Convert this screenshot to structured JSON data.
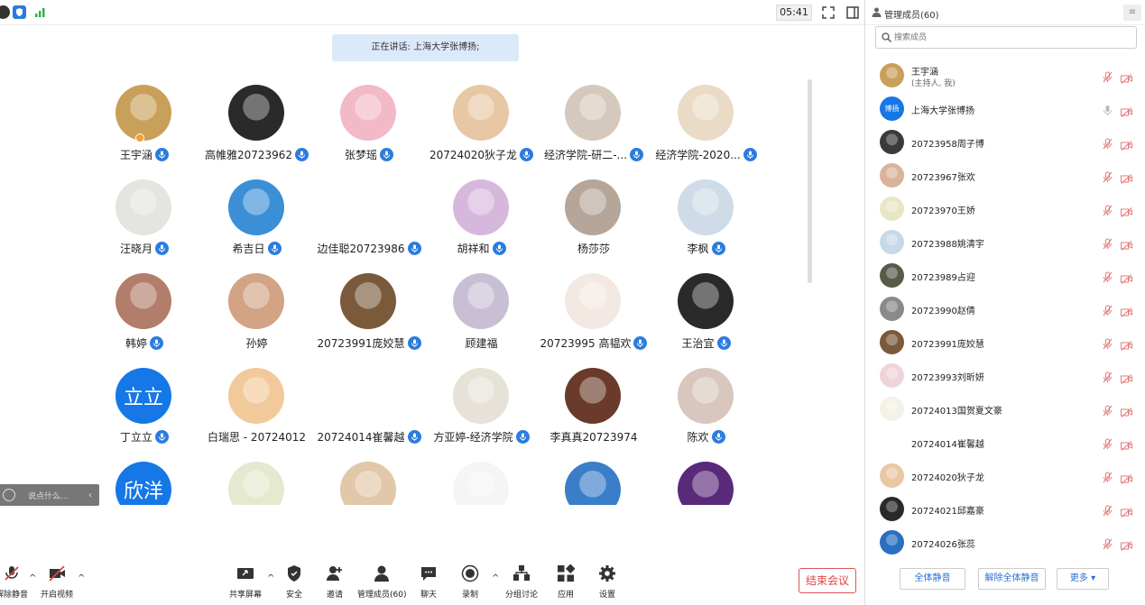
{
  "top": {
    "timer": "05:41",
    "speaking": "正在讲话: 上海大学张博扬;"
  },
  "participants": [
    {
      "name": "王宇涵",
      "mic": true,
      "bg": "#c9a05a",
      "host": true
    },
    {
      "name": "高帷雅20723962",
      "mic": true,
      "bg": "#2a2a2a"
    },
    {
      "name": "张梦瑶",
      "mic": true,
      "bg": "#f2b9c6"
    },
    {
      "name": "20724020狄子龙",
      "mic": true,
      "bg": "#e8c7a4"
    },
    {
      "name": "经济学院-研二-...",
      "mic": true,
      "bg": "#d5c8bc"
    },
    {
      "name": "经济学院-2020...",
      "mic": true,
      "bg": "#eadbc6"
    },
    {
      "name": "汪晓月",
      "mic": true,
      "bg": "#e4e4e0"
    },
    {
      "name": "希吉日",
      "mic": true,
      "bg": "#3b8fd6"
    },
    {
      "name": "边佳聪20723986",
      "mic": true,
      "bg": "#ffffff"
    },
    {
      "name": "胡祥和",
      "mic": true,
      "bg": "#d7b8dd"
    },
    {
      "name": "杨莎莎",
      "mic": false,
      "bg": "#b6a69a"
    },
    {
      "name": "李枫",
      "mic": true,
      "bg": "#cfdce7"
    },
    {
      "name": "韩婷",
      "mic": true,
      "bg": "#b27d6a"
    },
    {
      "name": "孙婷",
      "mic": false,
      "bg": "#d2a384"
    },
    {
      "name": "20723991庞姣慧",
      "mic": true,
      "bg": "#7a5a3a"
    },
    {
      "name": "顾建福",
      "mic": false,
      "bg": "#c9bfd5"
    },
    {
      "name": "20723995 高韫欢",
      "mic": true,
      "bg": "#f4e8e2"
    },
    {
      "name": "王治宜",
      "mic": true,
      "bg": "#2a2a2a"
    },
    {
      "name": "丁立立",
      "mic": true,
      "bg": "#1677e6",
      "text": "立立"
    },
    {
      "name": "白瑞思 - 20724012",
      "mic": false,
      "bg": "#f2c99a"
    },
    {
      "name": "20724014崔馨越",
      "mic": true,
      "bg": "#ffffff"
    },
    {
      "name": "方亚婷-经济学院",
      "mic": true,
      "bg": "#e7e2d8"
    },
    {
      "name": "李真真20723974",
      "mic": false,
      "bg": "#6a3a2a"
    },
    {
      "name": "陈欢",
      "mic": true,
      "bg": "#d8c6bf"
    },
    {
      "name": "",
      "mic": false,
      "bg": "#1677e6",
      "text": "欣洋"
    },
    {
      "name": "",
      "mic": false,
      "bg": "#e5e9d0"
    },
    {
      "name": "",
      "mic": false,
      "bg": "#e2c7a9"
    },
    {
      "name": "",
      "mic": false,
      "bg": "#f5f5f5"
    },
    {
      "name": "",
      "mic": false,
      "bg": "#3a7ec9"
    },
    {
      "name": "",
      "mic": false,
      "bg": "#5a2a7a"
    }
  ],
  "chat": {
    "placeholder": "说点什么..."
  },
  "toolbar": {
    "mute": "解除静音",
    "video": "开启视频",
    "share": "共享屏幕",
    "security": "安全",
    "invite": "邀请",
    "manage": "管理成员(60)",
    "chat": "聊天",
    "record": "录制",
    "breakout": "分组讨论",
    "apps": "应用",
    "settings": "设置",
    "end": "结束会议"
  },
  "panel": {
    "title": "管理成员(60)",
    "search_placeholder": "搜索成员",
    "members": [
      {
        "name": "王宇涵",
        "sub": "(主持人, 我)",
        "bg": "#c9a05a",
        "mic": "muted"
      },
      {
        "name": "上海大学张博扬",
        "bg": "#1677e6",
        "avatar_text": "博扬",
        "mic": "on"
      },
      {
        "name": "20723958周子博",
        "bg": "#3a3a3a",
        "mic": "muted"
      },
      {
        "name": "20723967张欢",
        "bg": "#d9b39a",
        "mic": "muted"
      },
      {
        "name": "20723970王娇",
        "bg": "#e9e6c7",
        "mic": "muted"
      },
      {
        "name": "20723988姚清宇",
        "bg": "#c7d9e8",
        "mic": "muted"
      },
      {
        "name": "20723989占迎",
        "bg": "#5a5a4a",
        "mic": "muted"
      },
      {
        "name": "20723990赵倩",
        "bg": "#8a8a8a",
        "mic": "muted"
      },
      {
        "name": "20723991庞姣慧",
        "bg": "#7a5a3a",
        "mic": "muted"
      },
      {
        "name": "20723993刘昕妍",
        "bg": "#f0d3da",
        "mic": "muted"
      },
      {
        "name": "20724013国贺夏文豪",
        "bg": "#f4f1e6",
        "mic": "muted"
      },
      {
        "name": "20724014崔馨越",
        "bg": "#ffffff",
        "mic": "muted"
      },
      {
        "name": "20724020狄子龙",
        "bg": "#e8c7a4",
        "mic": "muted"
      },
      {
        "name": "20724021邱嘉豪",
        "bg": "#2a2a2a",
        "mic": "muted"
      },
      {
        "name": "20724026张蕊",
        "bg": "#2a6fc0",
        "mic": "muted"
      }
    ],
    "mute_all": "全体静音",
    "unmute_all": "解除全体静音",
    "more": "更多 ▾"
  },
  "colors": {
    "accent": "#2b7ce0",
    "end": "#e04545",
    "muted": "#e57a7a"
  }
}
